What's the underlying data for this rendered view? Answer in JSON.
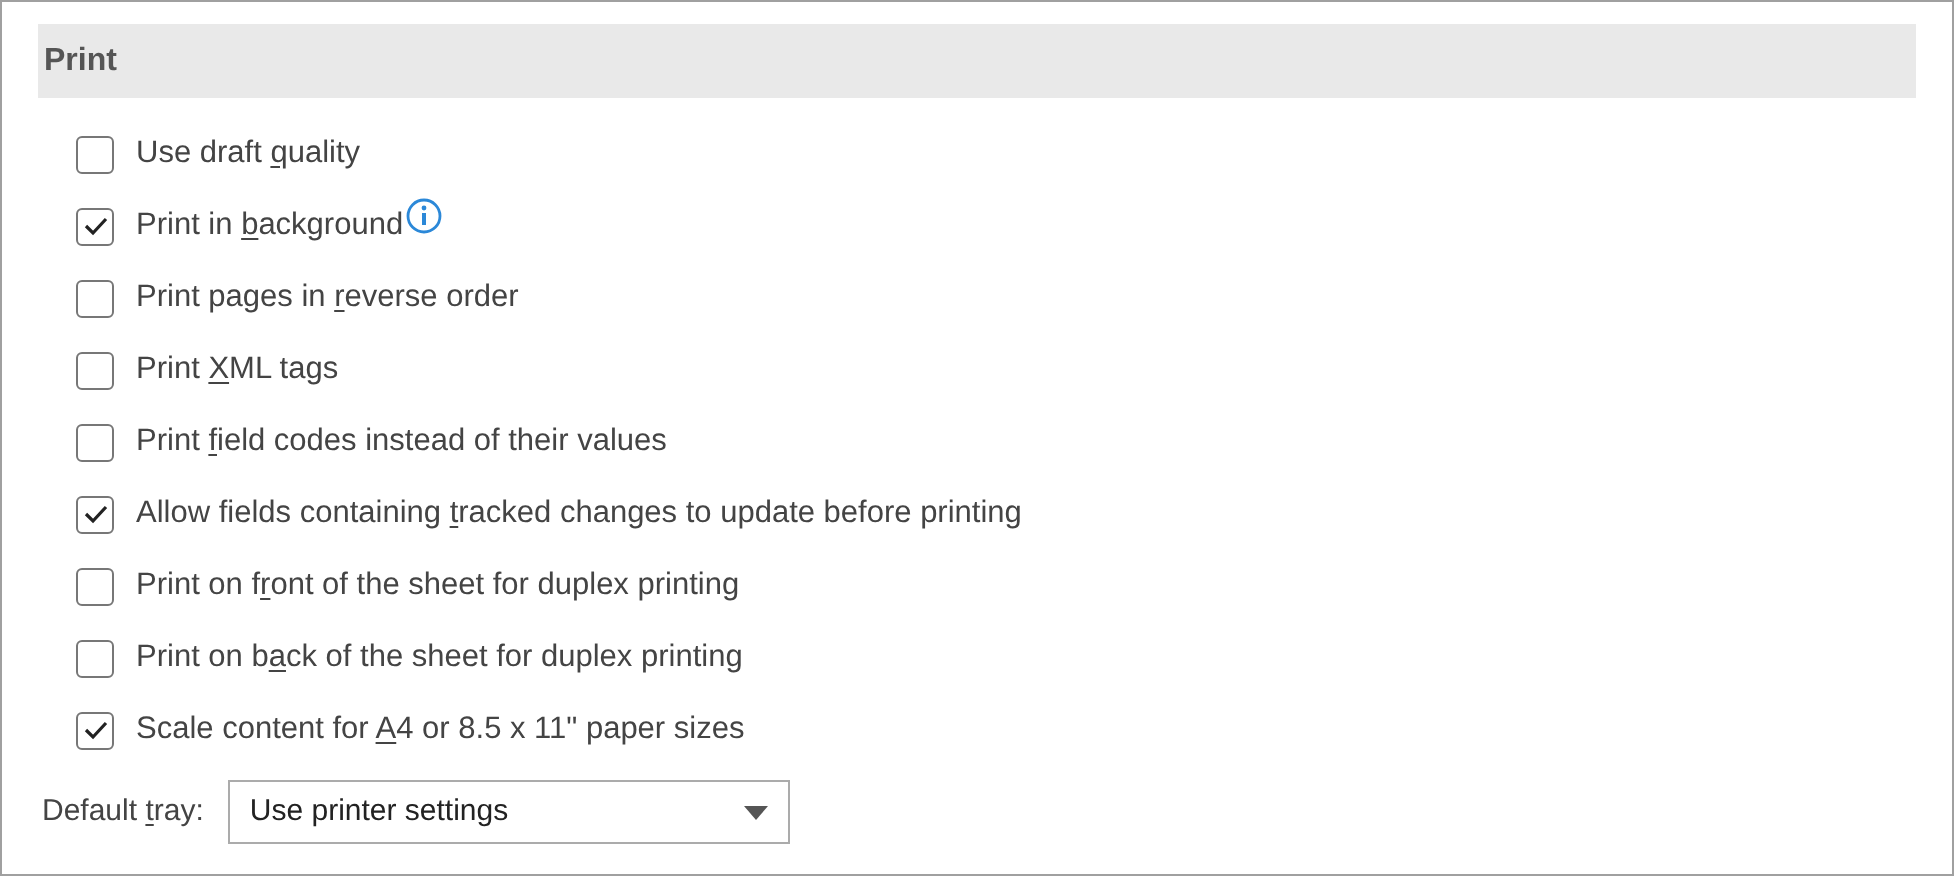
{
  "section": {
    "title": "Print"
  },
  "options": [
    {
      "label_parts": [
        "Use draft ",
        "q",
        "uality"
      ],
      "checked": false,
      "info": false
    },
    {
      "label_parts": [
        "Print in ",
        "b",
        "ackground"
      ],
      "checked": true,
      "info": true
    },
    {
      "label_parts": [
        "Print pages in ",
        "r",
        "everse order"
      ],
      "checked": false,
      "info": false
    },
    {
      "label_parts": [
        "Print ",
        "X",
        "ML tags"
      ],
      "checked": false,
      "info": false
    },
    {
      "label_parts": [
        "Print ",
        "f",
        "ield codes instead of their values"
      ],
      "checked": false,
      "info": false
    },
    {
      "label_parts": [
        "Allow fields containing ",
        "t",
        "racked changes to update before printing"
      ],
      "checked": true,
      "info": false
    },
    {
      "label_parts": [
        "Print on f",
        "r",
        "ont of the sheet for duplex printing"
      ],
      "checked": false,
      "info": false
    },
    {
      "label_parts": [
        "Print on b",
        "a",
        "ck of the sheet for duplex printing"
      ],
      "checked": false,
      "info": false
    },
    {
      "label_parts": [
        "Scale content for ",
        "A",
        "4 or 8.5 x 11\" paper sizes"
      ],
      "checked": true,
      "info": false
    }
  ],
  "default_tray": {
    "label_parts": [
      "Default ",
      "t",
      "ray:"
    ],
    "value": "Use printer settings"
  }
}
